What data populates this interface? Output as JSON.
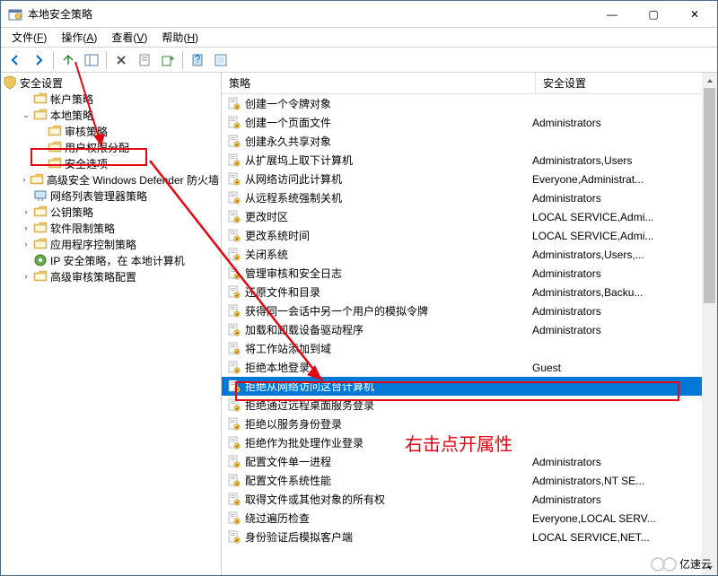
{
  "window": {
    "title": "本地安全策略",
    "controls": {
      "min": "—",
      "max": "▢",
      "close": "✕"
    }
  },
  "menu": [
    {
      "label": "文件",
      "accel": "F"
    },
    {
      "label": "操作",
      "accel": "A"
    },
    {
      "label": "查看",
      "accel": "V"
    },
    {
      "label": "帮助",
      "accel": "H"
    }
  ],
  "toolbar_icons": [
    "back",
    "forward",
    "up",
    "show-hide-tree",
    "delete",
    "properties",
    "refresh",
    "help",
    "export"
  ],
  "tree": {
    "root": "安全设置",
    "items": [
      {
        "indent": 0,
        "expand": "",
        "label": "帐户策略",
        "icon": "folder"
      },
      {
        "indent": 0,
        "expand": "v",
        "label": "本地策略",
        "icon": "folder"
      },
      {
        "indent": 1,
        "expand": "",
        "label": "审核策略",
        "icon": "folder"
      },
      {
        "indent": 1,
        "expand": "",
        "label": "用户权限分配",
        "icon": "folder",
        "highlight": true
      },
      {
        "indent": 1,
        "expand": "",
        "label": "安全选项",
        "icon": "folder"
      },
      {
        "indent": 0,
        "expand": ">",
        "label": "高级安全 Windows Defender 防火墙",
        "icon": "folder"
      },
      {
        "indent": 0,
        "expand": "",
        "label": "网络列表管理器策略",
        "icon": "net"
      },
      {
        "indent": 0,
        "expand": ">",
        "label": "公钥策略",
        "icon": "folder"
      },
      {
        "indent": 0,
        "expand": ">",
        "label": "软件限制策略",
        "icon": "folder"
      },
      {
        "indent": 0,
        "expand": ">",
        "label": "应用程序控制策略",
        "icon": "folder"
      },
      {
        "indent": 0,
        "expand": "",
        "label": "IP 安全策略，在 本地计算机",
        "icon": "ip"
      },
      {
        "indent": 0,
        "expand": ">",
        "label": "高级审核策略配置",
        "icon": "folder"
      }
    ]
  },
  "list": {
    "columns": [
      "策略",
      "安全设置"
    ],
    "rows": [
      {
        "name": "创建一个令牌对象",
        "value": ""
      },
      {
        "name": "创建一个页面文件",
        "value": "Administrators"
      },
      {
        "name": "创建永久共享对象",
        "value": ""
      },
      {
        "name": "从扩展坞上取下计算机",
        "value": "Administrators,Users"
      },
      {
        "name": "从网络访问此计算机",
        "value": "Everyone,Administrat..."
      },
      {
        "name": "从远程系统强制关机",
        "value": "Administrators"
      },
      {
        "name": "更改时区",
        "value": "LOCAL SERVICE,Admi..."
      },
      {
        "name": "更改系统时间",
        "value": "LOCAL SERVICE,Admi..."
      },
      {
        "name": "关闭系统",
        "value": "Administrators,Users,..."
      },
      {
        "name": "管理审核和安全日志",
        "value": "Administrators"
      },
      {
        "name": "还原文件和目录",
        "value": "Administrators,Backu..."
      },
      {
        "name": "获得同一会话中另一个用户的模拟令牌",
        "value": "Administrators"
      },
      {
        "name": "加载和卸载设备驱动程序",
        "value": "Administrators"
      },
      {
        "name": "将工作站添加到域",
        "value": ""
      },
      {
        "name": "拒绝本地登录",
        "value": "Guest"
      },
      {
        "name": "拒绝从网络访问这台计算机",
        "value": "",
        "selected": true
      },
      {
        "name": "拒绝通过远程桌面服务登录",
        "value": ""
      },
      {
        "name": "拒绝以服务身份登录",
        "value": ""
      },
      {
        "name": "拒绝作为批处理作业登录",
        "value": ""
      },
      {
        "name": "配置文件单一进程",
        "value": "Administrators"
      },
      {
        "name": "配置文件系统性能",
        "value": "Administrators,NT SE..."
      },
      {
        "name": "取得文件或其他对象的所有权",
        "value": "Administrators"
      },
      {
        "name": "绕过遍历检查",
        "value": "Everyone,LOCAL SERV..."
      },
      {
        "name": "身份验证后模拟客户端",
        "value": "LOCAL SERVICE,NET..."
      }
    ]
  },
  "annotation_text": "右击点开属性",
  "watermark": "亿速云"
}
